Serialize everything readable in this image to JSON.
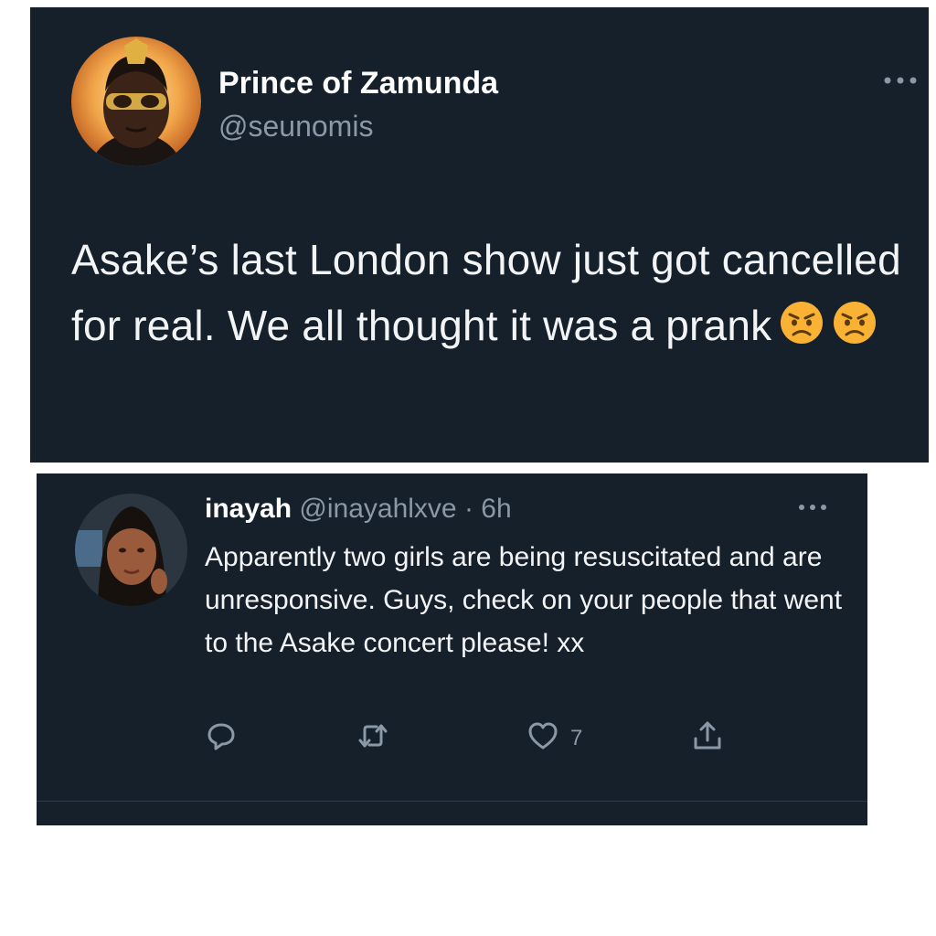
{
  "main_tweet": {
    "display_name": "Prince of Zamunda",
    "handle": "@seunomis",
    "text": "Asake’s last London show just got cancelled for real. We all thought it was a prank",
    "emojis": [
      "angry-face-emoji",
      "angry-face-emoji"
    ]
  },
  "reply_tweet": {
    "display_name": "inayah",
    "handle": "@inayahlxve",
    "separator": " · ",
    "time": "6h",
    "text": "Apparently two girls are being resuscitated and are unresponsive. Guys, check on your people that went to the Asake concert please! xx",
    "actions": {
      "reply_icon": "reply-icon",
      "retweet_icon": "retweet-icon",
      "like_icon": "heart-icon",
      "like_count": "7",
      "share_icon": "share-icon"
    }
  },
  "colors": {
    "card_background": "#15202b",
    "primary_text": "#ffffff",
    "secondary_text": "#8b98a5",
    "emoji_yellow": "#f9b233"
  }
}
